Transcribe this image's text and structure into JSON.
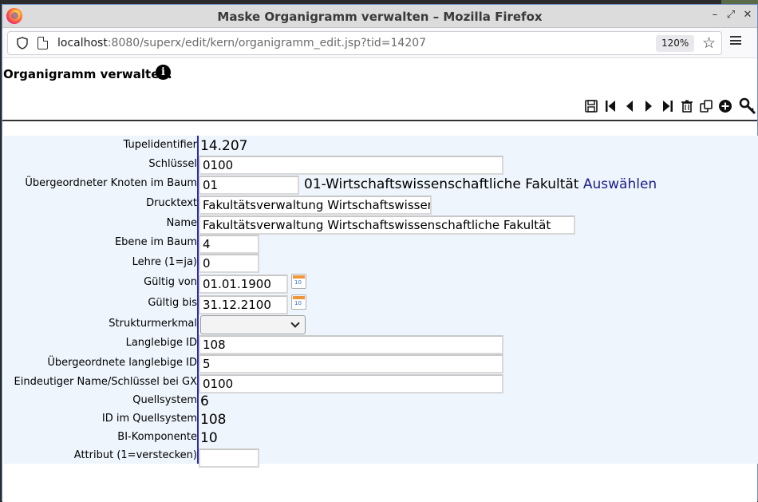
{
  "window": {
    "title": "Maske Organigramm verwalten – Mozilla Firefox",
    "controls": {
      "minimize": "–",
      "restore": "⤢",
      "close": "✕"
    }
  },
  "browser": {
    "url_host": "localhost",
    "url_rest": ":8080/superx/edit/kern/organigramm_edit.jsp?tid=14207",
    "zoom": "120%",
    "icons": [
      "shield-icon",
      "page-icon",
      "star-icon",
      "hamburger-menu-icon"
    ]
  },
  "page": {
    "heading": "Organigramm verwalten.",
    "info_icon_glyph": "i"
  },
  "toolbar": {
    "buttons": [
      "save-icon",
      "first-record-icon",
      "previous-record-icon",
      "next-record-icon",
      "last-record-icon",
      "delete-icon",
      "copy-icon",
      "add-icon",
      "key-icon"
    ]
  },
  "form": {
    "tupelidentifier": {
      "label": "Tupelidentifier",
      "value": "14.207"
    },
    "schluessel": {
      "label": "Schlüssel",
      "value": "0100"
    },
    "uebergeordneter_knoten": {
      "label": "Übergeordneter Knoten im Baum",
      "value": "01",
      "display": "01-Wirtschaftswissenschaftliche Fakultät",
      "link": "Auswählen"
    },
    "drucktext": {
      "label": "Drucktext",
      "value": "Fakultätsverwaltung Wirtschaftswissenscl"
    },
    "name": {
      "label": "Name",
      "value": "Fakultätsverwaltung Wirtschaftswissenschaftliche Fakultät"
    },
    "ebene": {
      "label": "Ebene im Baum",
      "value": "4"
    },
    "lehre": {
      "label": "Lehre (1=ja)",
      "value": "0"
    },
    "gueltig_von": {
      "label": "Gültig von",
      "value": "01.01.1900"
    },
    "gueltig_bis": {
      "label": "Gültig bis",
      "value": "31.12.2100"
    },
    "strukturmerkmal": {
      "label": "Strukturmerkmal",
      "value": ""
    },
    "langlebige_id": {
      "label": "Langlebige ID",
      "value": "108"
    },
    "uebergeordnete_langlebige_id": {
      "label": "Übergeordnete langlebige ID",
      "value": "5"
    },
    "eindeutiger_name": {
      "label": "Eindeutiger Name/Schlüssel bei GX",
      "value": "0100"
    },
    "quellsystem": {
      "label": "Quellsystem",
      "value": "6"
    },
    "id_quellsystem": {
      "label": "ID im Quellsystem",
      "value": "108"
    },
    "bi_komponente": {
      "label": "BI-Komponente",
      "value": "10"
    },
    "attribut": {
      "label": "Attribut (1=verstecken)",
      "value": ""
    }
  }
}
